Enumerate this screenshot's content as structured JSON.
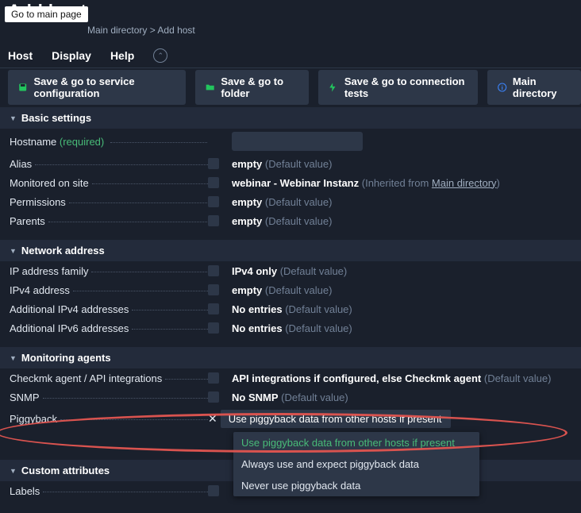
{
  "tooltip": "Go to main page",
  "page_title_partial": "Add host",
  "breadcrumb": {
    "item1": "Main directory",
    "sep": ">",
    "item2": "Add host"
  },
  "menubar": {
    "host": "Host",
    "display": "Display",
    "help": "Help",
    "arrow": "⌃"
  },
  "actions": {
    "save_svc": "Save & go to service configuration",
    "save_folder": "Save & go to folder",
    "save_conn": "Save & go to connection tests",
    "main_dir": "Main directory"
  },
  "sections": {
    "basic": {
      "title": "Basic settings",
      "hostname_label": "Hostname",
      "hostname_required": "(required)",
      "alias_label": "Alias",
      "alias_val": "empty",
      "alias_def": "(Default value)",
      "monitored_label": "Monitored on site",
      "monitored_val": "webinar - Webinar Instanz",
      "monitored_inh": "(Inherited from ",
      "monitored_link": "Main directory",
      "monitored_close": ")",
      "perm_label": "Permissions",
      "perm_val": "empty",
      "perm_def": "(Default value)",
      "parents_label": "Parents",
      "parents_val": "empty",
      "parents_def": "(Default value)"
    },
    "network": {
      "title": "Network address",
      "ipfam_label": "IP address family",
      "ipfam_val": "IPv4 only",
      "ipfam_def": "(Default value)",
      "ipv4_label": "IPv4 address",
      "ipv4_val": "empty",
      "ipv4_def": "(Default value)",
      "addv4_label": "Additional IPv4 addresses",
      "addv4_val": "No entries",
      "addv4_def": "(Default value)",
      "addv6_label": "Additional IPv6 addresses",
      "addv6_val": "No entries",
      "addv6_def": "(Default value)"
    },
    "agents": {
      "title": "Monitoring agents",
      "checkmk_label": "Checkmk agent / API integrations",
      "checkmk_val": "API integrations if configured, else Checkmk agent",
      "checkmk_def": "(Default value)",
      "snmp_label": "SNMP",
      "snmp_val": "No SNMP",
      "snmp_def": "(Default value)",
      "piggy_label": "Piggyback",
      "piggy_selected": "Use piggyback data from other hosts if present",
      "piggy_options": {
        "o1": "Use piggyback data from other hosts if present",
        "o2": "Always use and expect piggyback data",
        "o3": "Never use piggyback data"
      }
    },
    "custom": {
      "title": "Custom attributes",
      "labels_label": "Labels"
    }
  }
}
